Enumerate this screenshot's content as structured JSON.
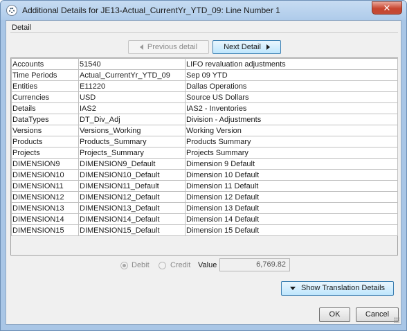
{
  "window": {
    "title": "Additional Details for JE13-Actual_CurrentYr_YTD_09: Line Number 1",
    "close_glyph": "✕"
  },
  "detail": {
    "label": "Detail",
    "previous_label": "Previous detail",
    "next_label": "Next Detail"
  },
  "rows": [
    {
      "dimension": "Accounts",
      "member": "51540",
      "description": "LIFO revaluation adjustments"
    },
    {
      "dimension": "Time Periods",
      "member": "Actual_CurrentYr_YTD_09",
      "description": "Sep 09 YTD"
    },
    {
      "dimension": "Entities",
      "member": "E11220",
      "description": "Dallas Operations"
    },
    {
      "dimension": "Currencies",
      "member": "USD",
      "description": "Source US Dollars"
    },
    {
      "dimension": "Details",
      "member": "IAS2",
      "description": "IAS2 - Inventories"
    },
    {
      "dimension": "DataTypes",
      "member": "DT_Div_Adj",
      "description": "Division - Adjustments"
    },
    {
      "dimension": "Versions",
      "member": "Versions_Working",
      "description": "Working Version"
    },
    {
      "dimension": "Products",
      "member": "Products_Summary",
      "description": "Products Summary"
    },
    {
      "dimension": "Projects",
      "member": "Projects_Summary",
      "description": "Projects Summary"
    },
    {
      "dimension": "DIMENSION9",
      "member": "DIMENSION9_Default",
      "description": "Dimension 9 Default"
    },
    {
      "dimension": "DIMENSION10",
      "member": "DIMENSION10_Default",
      "description": "Dimension 10 Default"
    },
    {
      "dimension": "DIMENSION11",
      "member": "DIMENSION11_Default",
      "description": "Dimension 11 Default"
    },
    {
      "dimension": "DIMENSION12",
      "member": "DIMENSION12_Default",
      "description": "Dimension 12 Default"
    },
    {
      "dimension": "DIMENSION13",
      "member": "DIMENSION13_Default",
      "description": "Dimension 13 Default"
    },
    {
      "dimension": "DIMENSION14",
      "member": "DIMENSION14_Default",
      "description": "Dimension 14 Default"
    },
    {
      "dimension": "DIMENSION15",
      "member": "DIMENSION15_Default",
      "description": "Dimension 15 Default"
    }
  ],
  "amount": {
    "debit_label": "Debit",
    "credit_label": "Credit",
    "selected": "Debit",
    "value_label": "Value",
    "value": "6,769.82"
  },
  "buttons": {
    "translation_label": "Show Translation Details",
    "ok_label": "OK",
    "cancel_label": "Cancel"
  },
  "colors": {
    "frame": "#a9c6e6",
    "accent_button": "#bee6fd",
    "close_button": "#c8452f"
  }
}
